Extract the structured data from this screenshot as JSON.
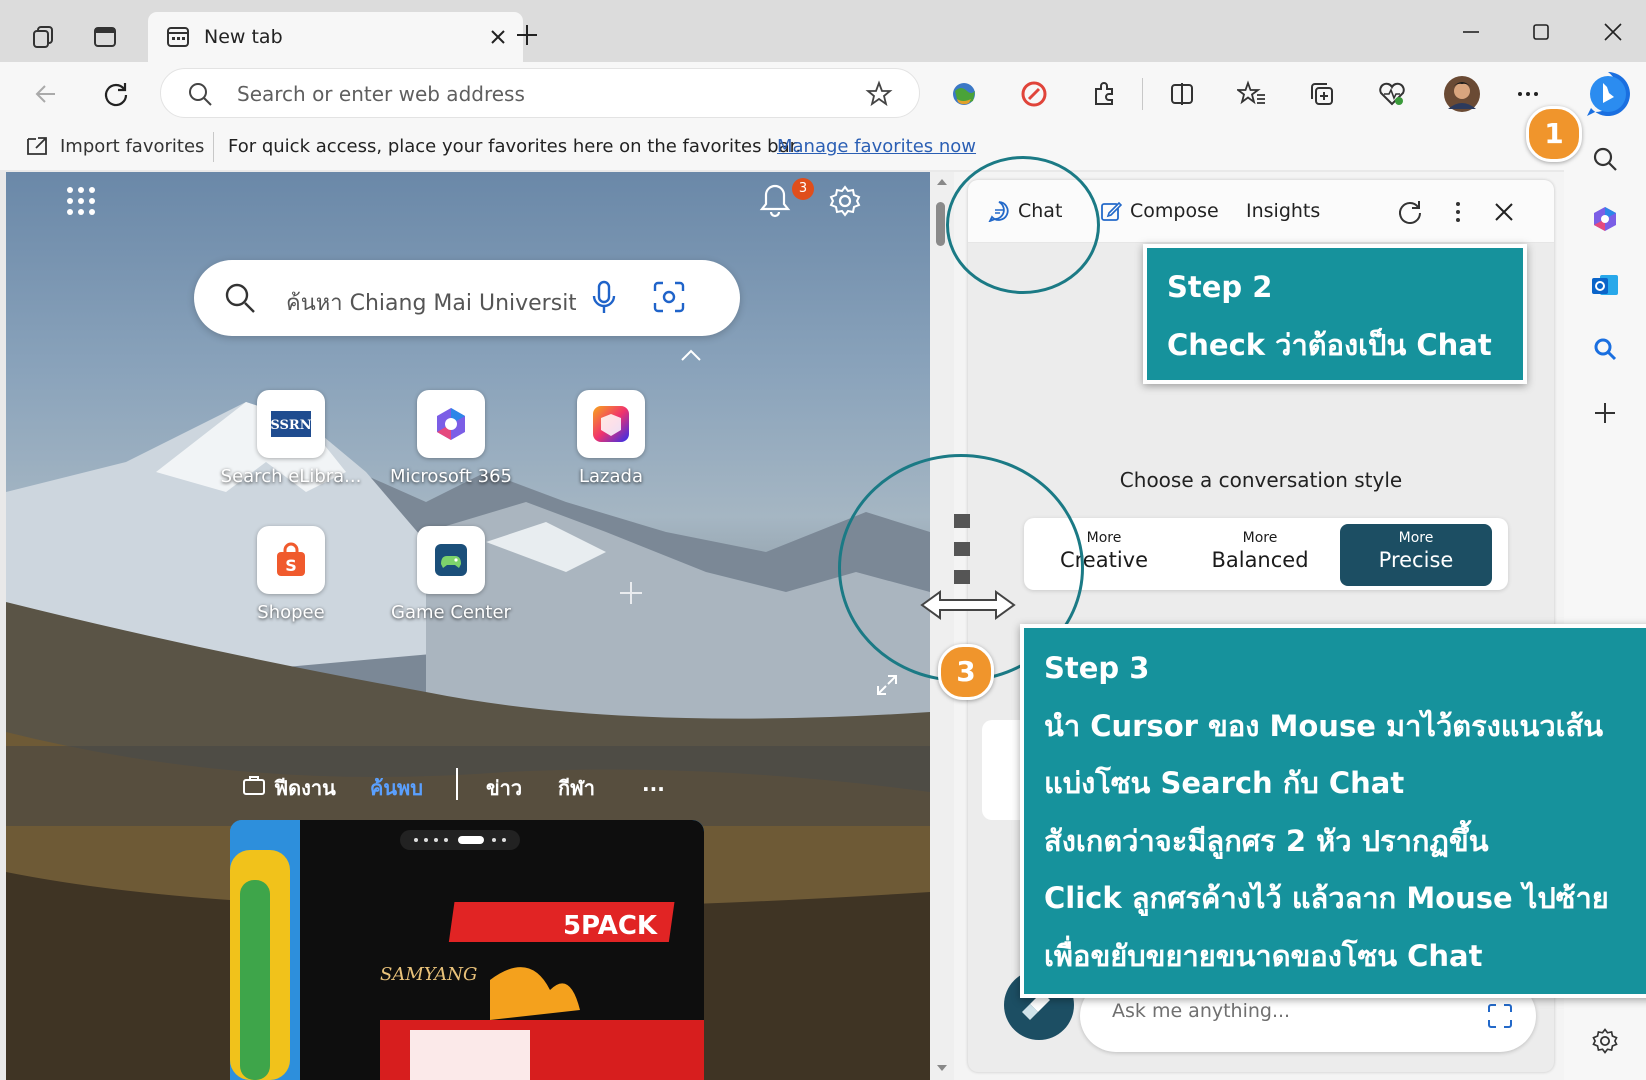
{
  "browser": {
    "tab_title": "New tab",
    "address_placeholder": "Search or enter web address",
    "favorites": {
      "import_label": "Import favorites",
      "message": "For quick access, place your favorites here on the favorites bar.",
      "manage_link": "Manage favorites now"
    },
    "profile_avatar": "avatar"
  },
  "newtab": {
    "notification_count": "3",
    "search_placeholder": "ค้นหา Chiang Mai University",
    "quick_links": [
      {
        "label": "Search eLibra...",
        "icon": "ssrn-icon"
      },
      {
        "label": "Microsoft 365",
        "icon": "microsoft-365-icon"
      },
      {
        "label": "Lazada",
        "icon": "lazada-icon"
      },
      {
        "label": "Shopee",
        "icon": "shopee-icon"
      },
      {
        "label": "Game Center",
        "icon": "game-center-icon"
      }
    ],
    "feed_tabs": [
      "ฟีดงาน",
      "ค้นพบ",
      "ข่าว",
      "กีฬา",
      "..."
    ]
  },
  "chat": {
    "tabs": [
      "Chat",
      "Compose",
      "Insights"
    ],
    "style_label": "Choose a conversation style",
    "styles": [
      {
        "small": "More",
        "large": "Creative"
      },
      {
        "small": "More",
        "large": "Balanced"
      },
      {
        "small": "More",
        "large": "Precise"
      }
    ],
    "selected_style": "Precise",
    "ask_placeholder": "Ask me anything..."
  },
  "annotations": {
    "step1_number": "1",
    "step3_number": "3",
    "step2_title": "Step 2",
    "step2_text": "Check ว่าต้องเป็น Chat",
    "step3_title": "Step 3",
    "step3_lines": [
      "นำ Cursor ของ Mouse มาไว้ตรงแนวเส้น",
      "แบ่งโซน Search กับ Chat",
      "สังเกตว่าจะมีลูกศร 2 หัว ปรากฏขึ้น",
      "Click ลูกศรค้างไว้ แล้วลาก Mouse ไปซ้าย",
      "เพื่อขยับขยายขนาดของโซน Chat"
    ]
  },
  "colors": {
    "accent_teal": "#16929c",
    "badge_orange": "#f0952c",
    "selected_style_bg": "#1c4e63",
    "link_blue": "#2b5fb4"
  }
}
